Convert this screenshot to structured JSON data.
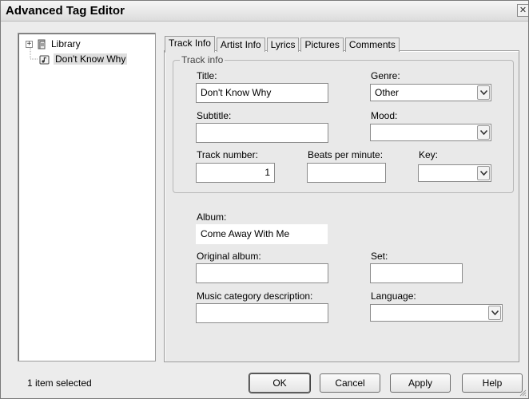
{
  "window": {
    "title": "Advanced Tag Editor",
    "close_glyph": "✕"
  },
  "tree": {
    "items": [
      {
        "label": "Library",
        "icon": "library-icon",
        "expander": "+"
      },
      {
        "label": "Don't Know Why",
        "icon": "music-file-icon",
        "selected": true
      }
    ]
  },
  "tabs": [
    {
      "label": "Track Info",
      "active": true
    },
    {
      "label": "Artist Info"
    },
    {
      "label": "Lyrics"
    },
    {
      "label": "Pictures"
    },
    {
      "label": "Comments"
    }
  ],
  "track_info": {
    "group_title": "Track info",
    "title_label": "Title:",
    "title_value": "Don't Know Why",
    "genre_label": "Genre:",
    "genre_value": "Other",
    "subtitle_label": "Subtitle:",
    "subtitle_value": "",
    "mood_label": "Mood:",
    "mood_value": "",
    "track_number_label": "Track number:",
    "track_number_value": "1",
    "bpm_label": "Beats per minute:",
    "bpm_value": "",
    "key_label": "Key:",
    "key_value": ""
  },
  "album_info": {
    "album_label": "Album:",
    "album_value": "Come Away With Me",
    "original_album_label": "Original album:",
    "original_album_value": "",
    "set_label": "Set:",
    "set_value": "",
    "music_category_label": "Music category description:",
    "music_category_value": "",
    "language_label": "Language:",
    "language_value": ""
  },
  "footer": {
    "status": "1 item selected",
    "ok": "OK",
    "cancel": "Cancel",
    "apply": "Apply",
    "help": "Help"
  }
}
